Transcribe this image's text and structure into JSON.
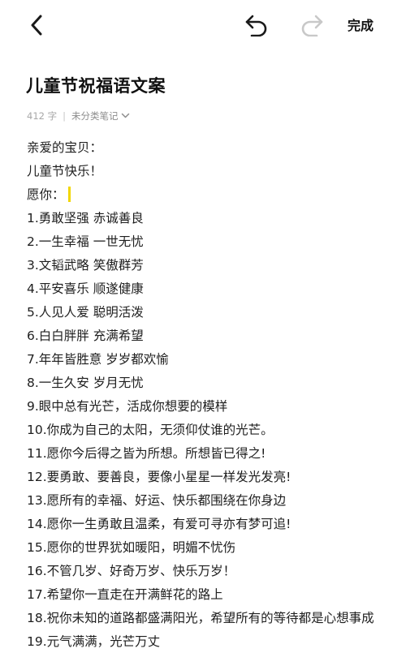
{
  "toolbar": {
    "back_icon": "chevron-left-icon",
    "undo_icon": "undo-icon",
    "redo_icon": "redo-icon",
    "done_label": "完成"
  },
  "note": {
    "title": "儿童节祝福语文案",
    "word_count": "412 字",
    "separator": "|",
    "folder": "未分类笔记",
    "lines": [
      "亲爱的宝贝：",
      "儿童节快乐！",
      "愿你：",
      "1.勇敢坚强 赤诚善良",
      "2.一生幸福 一世无忧",
      "3.文韬武略 笑傲群芳",
      "4.平安喜乐 顺遂健康",
      "5.人见人爱 聪明活泼",
      "6.白白胖胖 充满希望",
      "7.年年皆胜意 岁岁都欢愉",
      "8.一生久安 岁月无忧",
      "9.眼中总有光芒，活成你想要的模样",
      "10.你成为自己的太阳，无须仰仗谁的光芒。",
      "11.愿你今后得之皆为所想。所想皆已得之!",
      "12.要勇敢、要善良，要像小星星一样发光发亮!",
      "13.愿所有的幸福、好运、快乐都围绕在你身边",
      "14.愿你一生勇敢且温柔，有爱可寻亦有梦可追!",
      "15.愿你的世界犹如暖阳，明媚不忧伤",
      "16.不管几岁、好奇万岁、快乐万岁！",
      "17.希望你一直走在开满鲜花的路上",
      "18.祝你未知的道路都盛满阳光，希望所有的等待都是心想事成",
      "19.元气满满，光芒万丈"
    ]
  },
  "colors": {
    "cursor": "#f2d600",
    "text": "#1e1e1e",
    "meta": "#a8a8a8",
    "redo_disabled": "#c8c8c8"
  }
}
